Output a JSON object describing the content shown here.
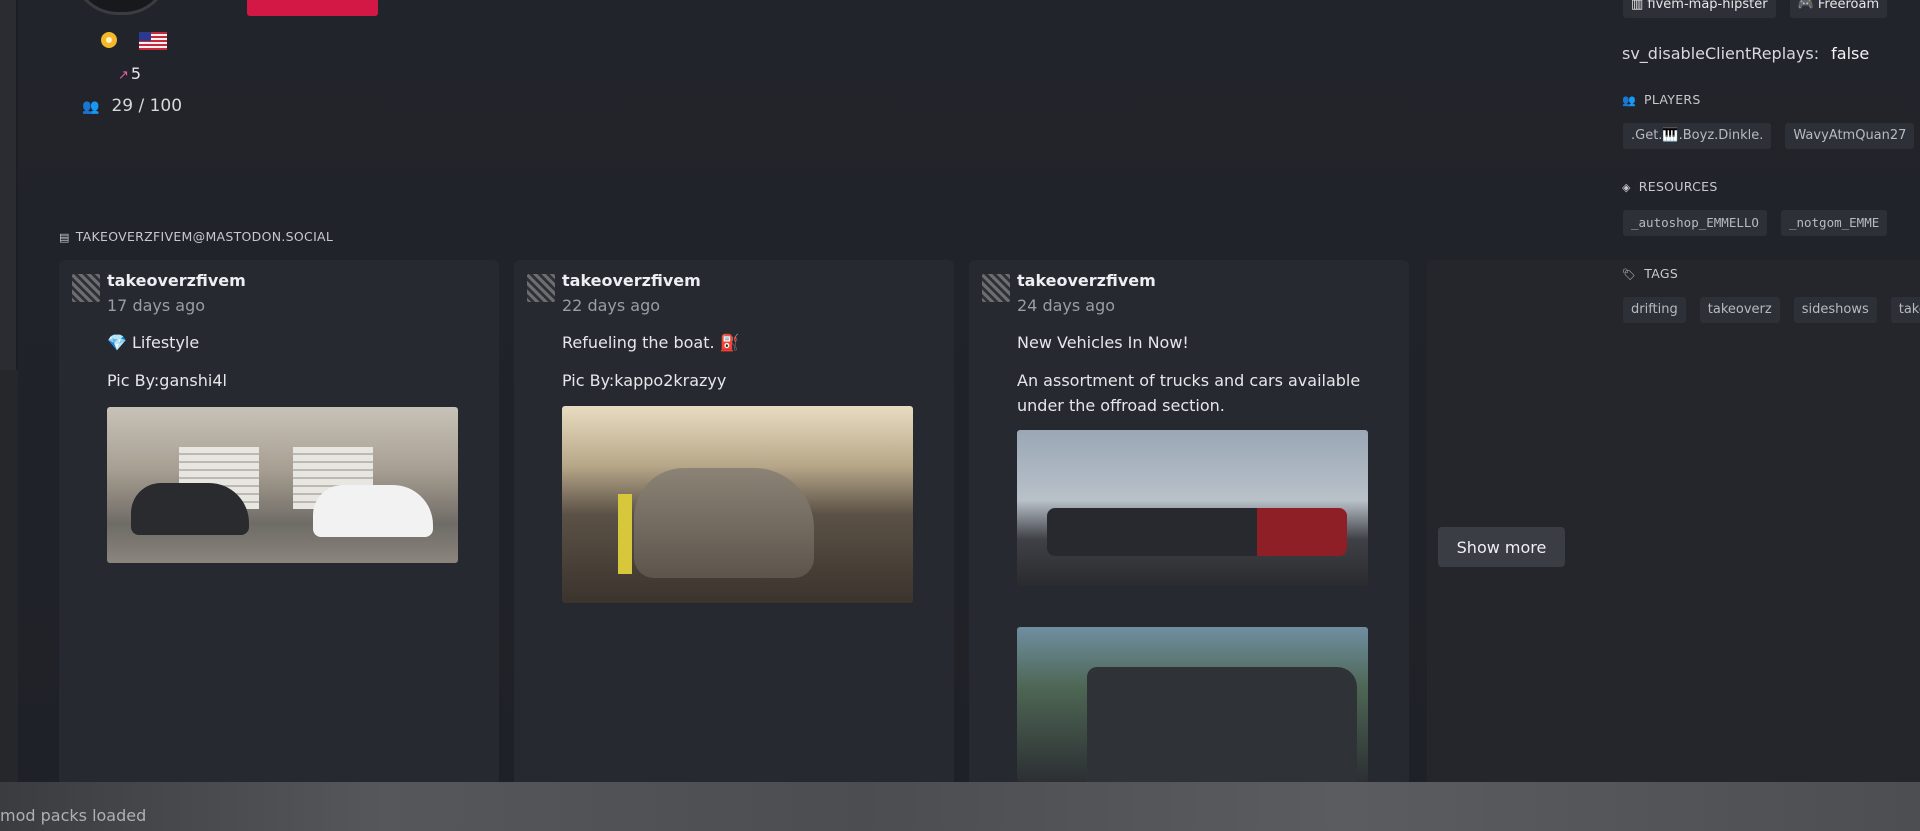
{
  "server": {
    "upvotes": "5",
    "players": "29 / 100"
  },
  "feed": {
    "header": "TAKEOVERZFIVEM@MASTODON.SOCIAL",
    "posts": [
      {
        "author": "takeoverzfivem",
        "time": "17 days ago",
        "lines": [
          "💎 Lifestyle",
          "Pic By:ganshi4l"
        ]
      },
      {
        "author": "takeoverzfivem",
        "time": "22 days ago",
        "lines": [
          "Refueling the boat. ⛽",
          "Pic By:kappo2krazyy"
        ]
      },
      {
        "author": "takeoverzfivem",
        "time": "24 days ago",
        "lines": [
          "New Vehicles In Now!",
          "An assortment of trucks and cars available under the offroad section."
        ]
      }
    ],
    "show_more": "Show more"
  },
  "sidebar": {
    "top_chips": [
      "fivem-map-hipster",
      "Freeroam"
    ],
    "var_key": "sv_disableClientReplays:",
    "var_value": "false",
    "players_title": "PLAYERS",
    "players": [
      ".Get.🎹.Boyz.Dinkle.",
      "WavyAtmQuan27"
    ],
    "resources_title": "RESOURCES",
    "resources": [
      "_autoshop_EMMELLO",
      "_notgom_EMME"
    ],
    "tags_title": "TAGS",
    "tags": [
      "drifting",
      "takeoverz",
      "sideshows",
      "take"
    ]
  },
  "status": "mod packs loaded",
  "colors": {
    "accent": "#d31845",
    "background": "#1c1e24",
    "card": "#272930"
  }
}
